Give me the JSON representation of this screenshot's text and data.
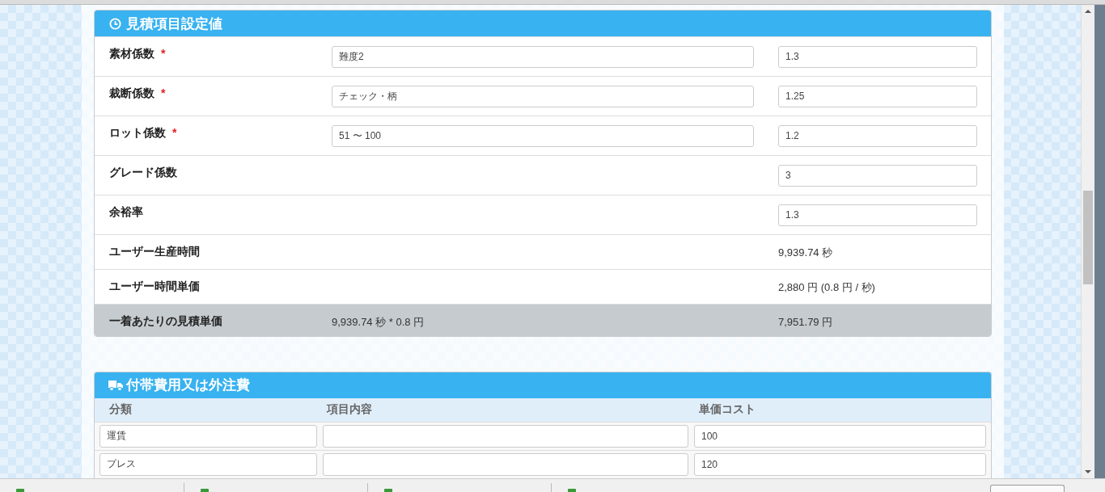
{
  "settings": {
    "title": "見積項目設定値",
    "rows": [
      {
        "kind": "coefficient",
        "label": "素材係数",
        "required_mark": "*",
        "option": "難度2",
        "value": "1.3"
      },
      {
        "kind": "coefficient",
        "label": "裁断係数",
        "required_mark": "*",
        "option": "チェック・柄",
        "value": "1.25"
      },
      {
        "kind": "coefficient",
        "label": "ロット係数",
        "required_mark": "*",
        "option": "51 〜 100",
        "value": "1.2"
      },
      {
        "kind": "input",
        "label": "グレード係数",
        "value": "3"
      },
      {
        "kind": "input",
        "label": "余裕率",
        "value": "1.3"
      },
      {
        "kind": "computed",
        "label": "ユーザー生産時間",
        "value": "9,939.74 秒"
      },
      {
        "kind": "computed",
        "label": "ユーザー時間単価",
        "value": "2,880 円 (0.8 円 / 秒)"
      },
      {
        "kind": "total",
        "label": "一着あたりの見積単価",
        "formula": "9,939.74 秒 * 0.8 円",
        "value": "7,951.79 円"
      }
    ]
  },
  "expenses": {
    "title": "付帯費用又は外注費",
    "columns": [
      "分類",
      "項目内容",
      "単価コスト"
    ],
    "rows": [
      {
        "category": "運賃",
        "unit_cost": "100"
      },
      {
        "category": "プレス",
        "unit_cost": "120"
      }
    ]
  }
}
